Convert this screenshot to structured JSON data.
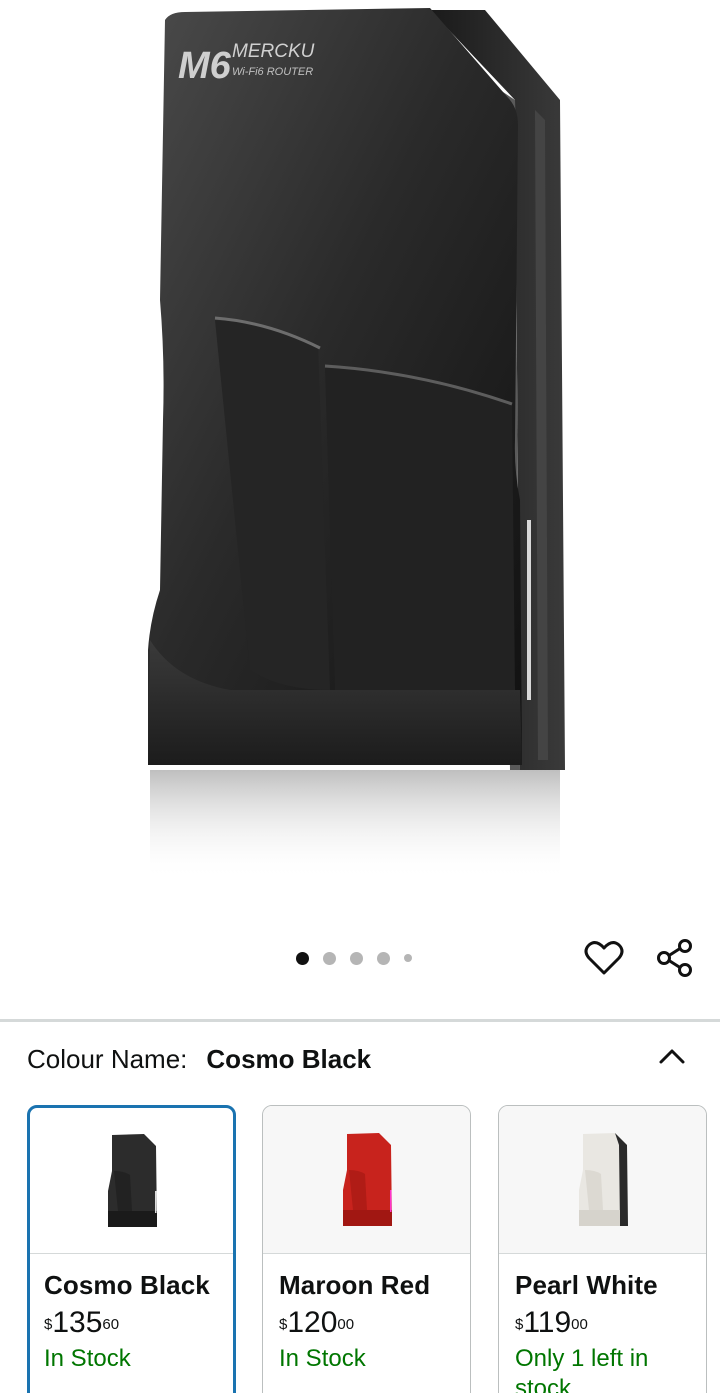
{
  "product": {
    "brand_logo_text": "M6",
    "brand_name": "MERCKU",
    "brand_tagline": "Wi-Fi6 ROUTER"
  },
  "carousel": {
    "total_images": 5,
    "active_index": 0
  },
  "actions": {
    "wishlist_icon": "heart-icon",
    "share_icon": "share-icon"
  },
  "colour": {
    "label": "Colour Name:",
    "selected": "Cosmo Black",
    "collapse_icon": "chevron-up-icon"
  },
  "variants": [
    {
      "name": "Cosmo Black",
      "currency": "$",
      "price_whole": "135",
      "price_fraction": "60",
      "stock": "In Stock",
      "swatch_color": "#2c2c2c",
      "selected": true
    },
    {
      "name": "Maroon Red",
      "currency": "$",
      "price_whole": "120",
      "price_fraction": "00",
      "stock": "In Stock",
      "swatch_color": "#c8231d",
      "selected": false
    },
    {
      "name": "Pearl White",
      "currency": "$",
      "price_whole": "119",
      "price_fraction": "00",
      "stock": "Only 1 left in stock.",
      "swatch_color": "#e9e7e2",
      "selected": false
    }
  ],
  "colors": {
    "link_blue": "#1a73b0",
    "stock_green": "#007600",
    "divider": "#d5d9d9"
  }
}
